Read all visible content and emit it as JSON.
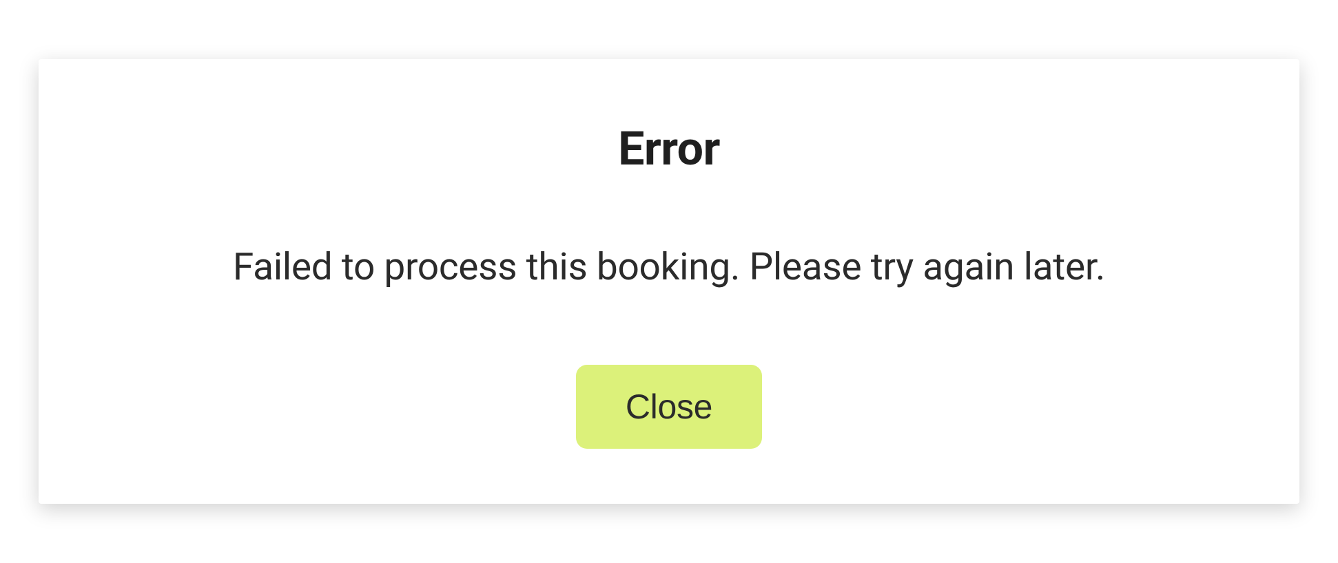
{
  "dialog": {
    "title": "Error",
    "message": "Failed to process this booking. Please try again later.",
    "close_label": "Close"
  }
}
